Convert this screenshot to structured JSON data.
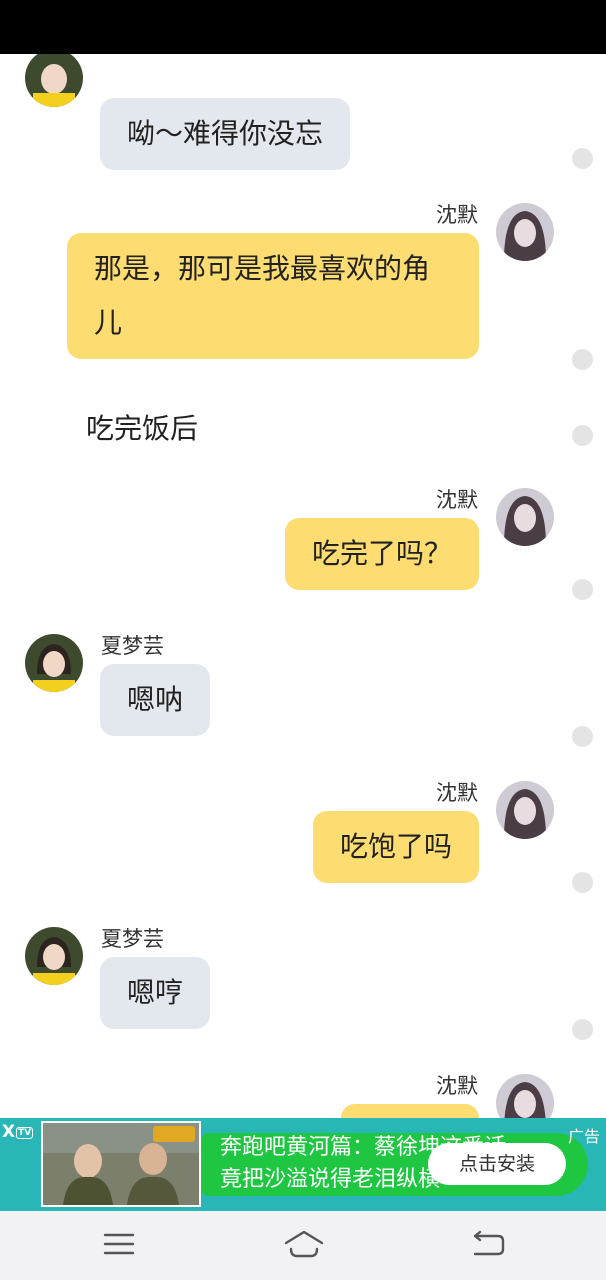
{
  "messages": {
    "m1_text": "呦～难得你没忘",
    "m2_name": "沈默",
    "m2_text": "那是，那可是我最喜欢的角儿",
    "narration": "吃完饭后",
    "m3_name": "沈默",
    "m3_text": "吃完了吗？",
    "m4_name": "夏梦芸",
    "m4_text": "嗯呐",
    "m5_name": "沈默",
    "m5_text": "吃饱了吗",
    "m6_name": "夏梦芸",
    "m6_text": "嗯哼",
    "m7_name": "沈默"
  },
  "ad": {
    "close": "X",
    "close_tag": "TV",
    "text": "奔跑吧黄河篇：蔡徐坤这番话竟把沙溢说得老泪纵横",
    "install_label": "点击安装",
    "label": "广告"
  },
  "colors": {
    "my_bubble": "#fddd72",
    "their_bubble": "#e3e8ef",
    "ad_bg": "#28b7b6",
    "ad_green": "#1fc642"
  },
  "icons": {
    "menu": "menu-icon",
    "home": "home-icon",
    "back": "back-icon"
  }
}
